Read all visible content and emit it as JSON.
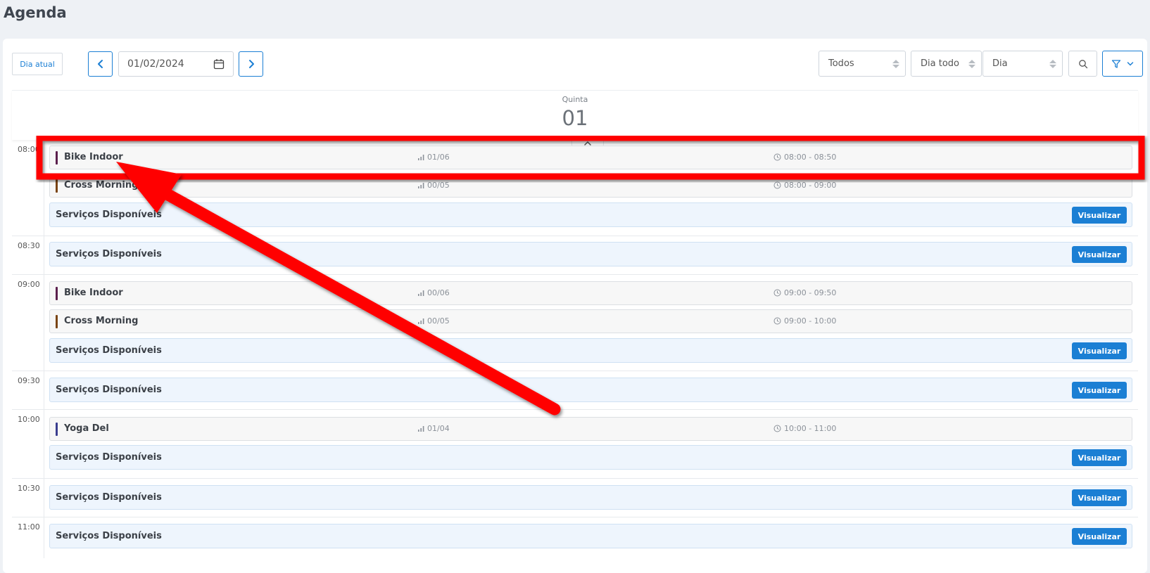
{
  "page": {
    "title": "Agenda"
  },
  "toolbar": {
    "today_label": "Dia atual",
    "date_value": "01/02/2024",
    "filter_all": "Todos",
    "filter_period": "Dia todo",
    "filter_view": "Dia"
  },
  "day_header": {
    "weekday": "Quinta",
    "day": "01"
  },
  "time_slots": [
    "08:00",
    "08:30",
    "09:00",
    "09:30",
    "10:00",
    "10:30",
    "11:00"
  ],
  "events": [
    {
      "name": "Bike Indoor",
      "capacity": "01/06",
      "time": "08:00 - 08:50",
      "color": "#5b1f4d"
    },
    {
      "name": "Cross Morning",
      "capacity": "00/05",
      "time": "08:00 - 09:00",
      "color": "#7a4414"
    },
    {
      "name": "Bike Indoor",
      "capacity": "00/06",
      "time": "09:00 - 09:50",
      "color": "#5b1f4d"
    },
    {
      "name": "Cross Morning",
      "capacity": "00/05",
      "time": "09:00 - 10:00",
      "color": "#7a4414"
    },
    {
      "name": "Yoga Del",
      "capacity": "01/04",
      "time": "10:00 - 11:00",
      "color": "#3a3d8f"
    }
  ],
  "services": {
    "label": "Serviços Disponíveis",
    "button": "Visualizar"
  },
  "colors": {
    "accent": "#1b7fd4",
    "annotation": "#ff0000"
  }
}
